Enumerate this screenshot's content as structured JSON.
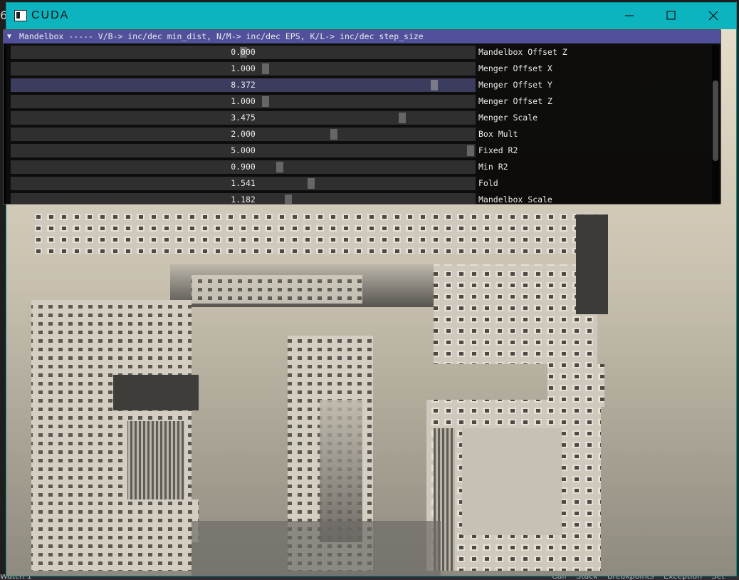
{
  "background": {
    "left_char": "6",
    "bottom_left": "Watch 1",
    "bottom_right": "Call Stack  Breakpoints  Exception Set"
  },
  "window": {
    "title": "CUDA",
    "titlebar_color": "#0bb4be"
  },
  "panel": {
    "title": "Mandelbox ----- V/B-> inc/dec min_dist, N/M-> inc/dec EPS, K/L-> inc/dec step_size",
    "header_color": "#51509a",
    "sliders": [
      {
        "label": "Mandelbox Offset Z",
        "value": "0.000",
        "fraction": 0.5,
        "active": false
      },
      {
        "label": "Menger Offset X",
        "value": "1.000",
        "fraction": 0.55,
        "active": false
      },
      {
        "label": "Menger Offset Y",
        "value": "8.372",
        "fraction": 0.92,
        "active": true
      },
      {
        "label": "Menger Offset Z",
        "value": "1.000",
        "fraction": 0.55,
        "active": false
      },
      {
        "label": "Menger Scale",
        "value": "3.475",
        "fraction": 0.85,
        "active": false
      },
      {
        "label": "Box Mult",
        "value": "2.000",
        "fraction": 0.7,
        "active": false
      },
      {
        "label": "Fixed R2",
        "value": "5.000",
        "fraction": 1.0,
        "active": false
      },
      {
        "label": "Min R2",
        "value": "0.900",
        "fraction": 0.58,
        "active": false
      },
      {
        "label": "Fold",
        "value": "1.541",
        "fraction": 0.65,
        "active": false
      },
      {
        "label": "Mandelbox Scale",
        "value": "1.182",
        "fraction": 0.6,
        "active": false
      }
    ]
  }
}
